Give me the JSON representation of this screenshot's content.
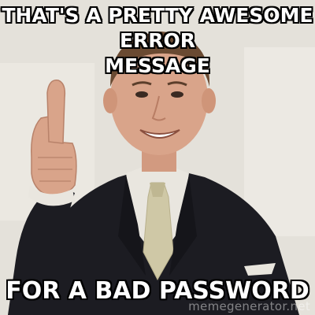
{
  "meme": {
    "top_text_line1": "THAT'S A PRETTY AWESOME ERROR",
    "top_text_line2": "MESSAGE",
    "bottom_text": "FOR A BAD PASSWORD",
    "watermark": "memegenerator.net"
  },
  "colors": {
    "text": "#ffffff",
    "outline": "#000000",
    "suit": "#1c1c22",
    "shirt": "#e9e6df",
    "tie": "#cfc8a6",
    "skin": "#d9a48a",
    "hair": "#6a4a32",
    "background": "#e3e0d8"
  },
  "image": {
    "subject": "smiling man in dark suit giving a thumbs up"
  }
}
